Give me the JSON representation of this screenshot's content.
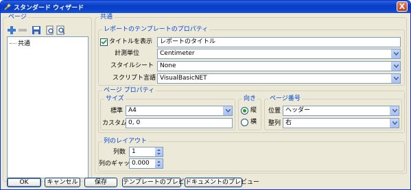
{
  "window": {
    "title": "スタンダード ウィザード",
    "close_label": "X"
  },
  "pages_panel": {
    "title": "ページ",
    "tree_items": [
      "共通"
    ]
  },
  "common": {
    "title": "共通",
    "report_template": {
      "title": "レポートのテンプレートのプロパティ",
      "show_title_label": "タイトルを表示",
      "show_title_checked": true,
      "title_value": "レポートのタイトル",
      "unit_label": "計測単位",
      "unit_value": "Centimeter",
      "stylesheet_label": "スタイルシート",
      "stylesheet_value": "None",
      "script_label": "スクリプト言語",
      "script_value": "VisualBasicNET"
    },
    "page_props": {
      "title": "ページ プロパティ",
      "size": {
        "title": "サイズ",
        "standard_label": "標準",
        "standard_value": "A4",
        "custom_label": "カスタム",
        "custom_value": "0, 0"
      },
      "orientation": {
        "title": "向き",
        "portrait_label": "縦",
        "landscape_label": "横",
        "selected": "portrait"
      },
      "page_number": {
        "title": "ページ番号",
        "position_label": "位置",
        "position_value": "ヘッダー",
        "align_label": "整列",
        "align_value": "右"
      }
    },
    "column_layout": {
      "title": "列のレイアウト",
      "count_label": "列数",
      "count_value": "1",
      "gap_label": "列のギャップ",
      "gap_value": "0.000"
    }
  },
  "buttons": {
    "ok": "OK",
    "cancel": "キャンセル",
    "save": "保存",
    "template_preview": "テンプレートのプレビュー",
    "document_preview": "ドキュメントのプレビュー"
  },
  "colors": {
    "titlebar": "#0a3cc9",
    "group_title": "#0046d5",
    "window_bg": "#ece9d8"
  },
  "icons": [
    "add-icon",
    "remove-icon",
    "save-icon",
    "preview-icon",
    "zoom-icon",
    "dropdown-arrow-icon"
  ]
}
